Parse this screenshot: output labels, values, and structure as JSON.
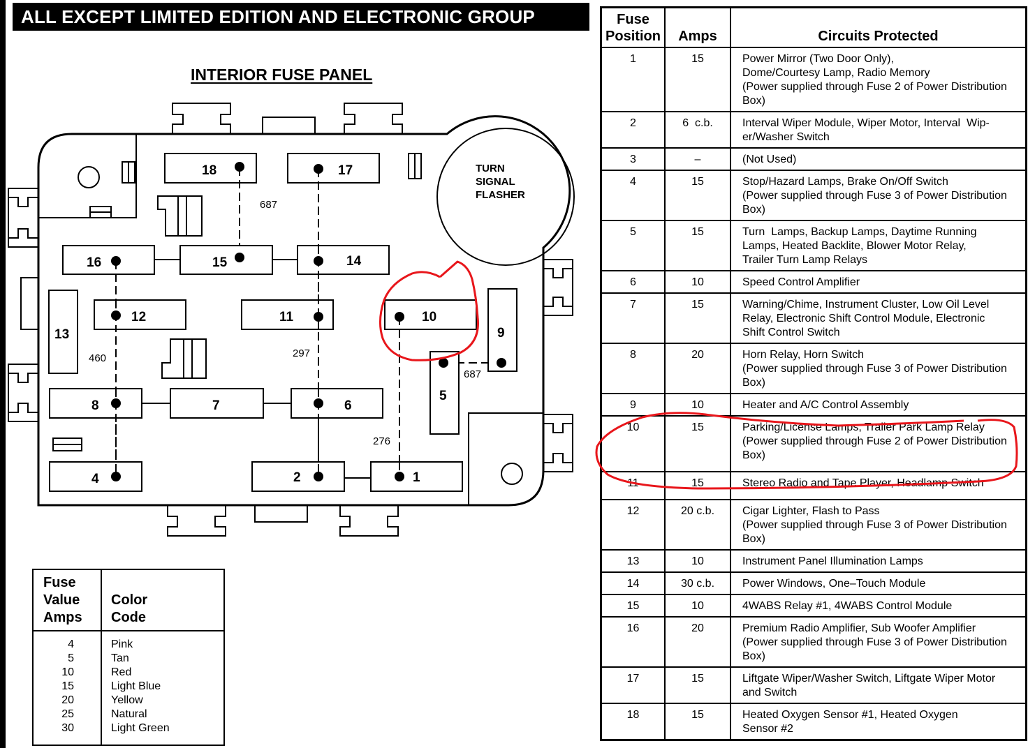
{
  "title": "ALL EXCEPT LIMITED EDITION AND ELECTRONIC GROUP",
  "panel": {
    "heading": "INTERIOR FUSE PANEL",
    "flasher_label": [
      "TURN",
      "SIGNAL",
      "FLASHER"
    ],
    "fuses": [
      {
        "num": "1"
      },
      {
        "num": "2"
      },
      {
        "num": "4"
      },
      {
        "num": "5"
      },
      {
        "num": "6"
      },
      {
        "num": "7"
      },
      {
        "num": "8"
      },
      {
        "num": "9"
      },
      {
        "num": "10"
      },
      {
        "num": "11"
      },
      {
        "num": "12"
      },
      {
        "num": "13"
      },
      {
        "num": "14"
      },
      {
        "num": "15"
      },
      {
        "num": "16"
      },
      {
        "num": "17"
      },
      {
        "num": "18"
      }
    ],
    "circuit_labels": {
      "c687_top": "687",
      "c687_right": "687",
      "c460": "460",
      "c297": "297",
      "c276": "276"
    },
    "highlighted_fuse": "10",
    "highlight_color": "#e8161b"
  },
  "color_code": {
    "header_amps": [
      "Fuse",
      "Value",
      "Amps"
    ],
    "header_color": [
      "Color",
      "Code"
    ],
    "rows": [
      {
        "amps": "4",
        "color": "Pink"
      },
      {
        "amps": "5",
        "color": "Tan"
      },
      {
        "amps": "10",
        "color": "Red"
      },
      {
        "amps": "15",
        "color": "Light Blue"
      },
      {
        "amps": "20",
        "color": "Yellow"
      },
      {
        "amps": "25",
        "color": "Natural"
      },
      {
        "amps": "30",
        "color": "Light Green"
      }
    ]
  },
  "fuse_table": {
    "headers": {
      "position": [
        "Fuse",
        "Position"
      ],
      "amps": "Amps",
      "circuits": "Circuits Protected"
    },
    "rows": [
      {
        "pos": "1",
        "amps": "15",
        "circuits": [
          "Power Mirror (Two Door Only),",
          "Dome/Courtesy Lamp, Radio Memory",
          "(Power supplied through Fuse 2 of Power Distribution",
          "Box)"
        ]
      },
      {
        "pos": "2",
        "amps": "6  c.b.",
        "circuits": [
          "Interval Wiper Module, Wiper Motor, Interval  Wip-",
          "er/Washer Switch"
        ]
      },
      {
        "pos": "3",
        "amps": "–",
        "circuits": [
          "(Not Used)"
        ]
      },
      {
        "pos": "4",
        "amps": "15",
        "circuits": [
          "Stop/Hazard Lamps, Brake On/Off Switch",
          "(Power supplied through Fuse 3 of Power Distribution",
          "Box)"
        ]
      },
      {
        "pos": "5",
        "amps": "15",
        "circuits": [
          "Turn  Lamps, Backup Lamps, Daytime Running",
          "Lamps, Heated Backlite, Blower Motor Relay,",
          "Trailer Turn Lamp Relays"
        ]
      },
      {
        "pos": "6",
        "amps": "10",
        "circuits": [
          "Speed Control Amplifier"
        ]
      },
      {
        "pos": "7",
        "amps": "15",
        "circuits": [
          "Warning/Chime, Instrument Cluster, Low Oil Level",
          "Relay, Electronic Shift Control Module, Electronic",
          "Shift Control Switch"
        ]
      },
      {
        "pos": "8",
        "amps": "20",
        "circuits": [
          "Horn Relay, Horn Switch",
          "(Power supplied through Fuse 3 of Power Distribution",
          "Box)"
        ]
      },
      {
        "pos": "9",
        "amps": "10",
        "circuits": [
          "Heater and A/C Control Assembly"
        ]
      },
      {
        "pos": "10",
        "amps": "15",
        "circuits": [
          "Parking/License Lamps, Trailer Park Lamp Relay",
          "(Power supplied through Fuse 2 of Power Distribution",
          "Box)"
        ]
      },
      {
        "pos": "11",
        "amps": "15",
        "circuits": [
          "Stereo Radio and Tape Player, Headlamp Switch"
        ]
      },
      {
        "pos": "12",
        "amps": "20 c.b.",
        "circuits": [
          "Cigar Lighter, Flash to Pass",
          "(Power supplied through Fuse 3 of Power Distribution",
          "Box)"
        ]
      },
      {
        "pos": "13",
        "amps": "10",
        "circuits": [
          "Instrument Panel Illumination Lamps"
        ]
      },
      {
        "pos": "14",
        "amps": "30 c.b.",
        "circuits": [
          "Power Windows, One–Touch Module"
        ]
      },
      {
        "pos": "15",
        "amps": "10",
        "circuits": [
          "4WABS Relay #1, 4WABS Control Module"
        ]
      },
      {
        "pos": "16",
        "amps": "20",
        "circuits": [
          "Premium Radio Amplifier, Sub Woofer Amplifier",
          "(Power supplied through Fuse 3 of Power Distribution",
          "Box)"
        ]
      },
      {
        "pos": "17",
        "amps": "15",
        "circuits": [
          "Liftgate Wiper/Washer Switch, Liftgate Wiper Motor",
          "and Switch"
        ]
      },
      {
        "pos": "18",
        "amps": "15",
        "circuits": [
          "Heated Oxygen Sensor #1, Heated Oxygen",
          "Sensor #2"
        ]
      }
    ]
  }
}
